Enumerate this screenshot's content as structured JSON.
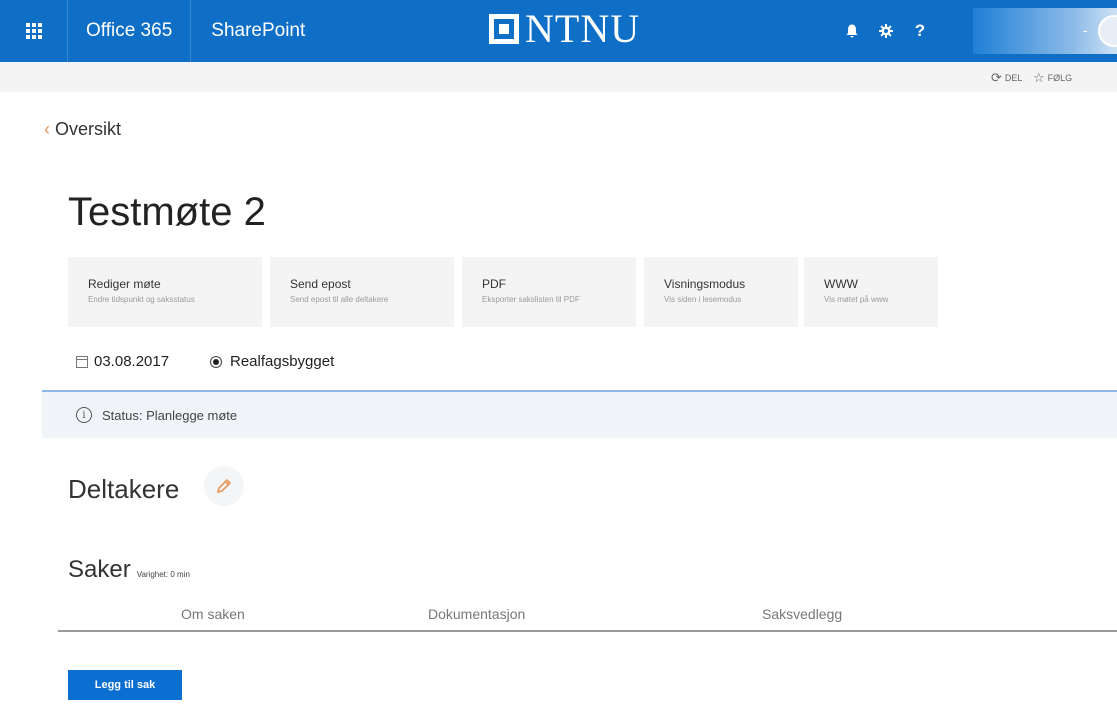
{
  "suitebar": {
    "app_name": "Office 365",
    "site_name": "SharePoint",
    "logo_text": "NTNU",
    "icons": [
      "bell-icon",
      "gear-icon",
      "help-icon"
    ],
    "help_label": "?",
    "user_separator": "-",
    "colors": {
      "bar": "#0f6fc6"
    }
  },
  "ribbon": {
    "share_label": "DEL",
    "follow_label": "FØLG"
  },
  "back_label": "Oversikt",
  "page_title": "Testmøte 2",
  "actions": [
    {
      "title": "Rediger møte",
      "subtitle": "Endre tidspunkt og saksstatus"
    },
    {
      "title": "Send epost",
      "subtitle": "Send epost til alle deltakere"
    },
    {
      "title": "PDF",
      "subtitle": "Eksporter sakslisten til PDF"
    },
    {
      "title": "Visningsmodus",
      "subtitle": "Vis siden i lesemodus"
    },
    {
      "title": "WWW",
      "subtitle": "Vis møtet på www"
    }
  ],
  "meeting": {
    "date": "03.08.2017",
    "location": "Realfagsbygget"
  },
  "status": {
    "text": "Status: Planlegge møte"
  },
  "participants": {
    "heading": "Deltakere"
  },
  "cases": {
    "heading": "Saker",
    "duration": "Varighet: 0 min",
    "columns": [
      "Om saken",
      "Dokumentasjon",
      "Saksvedlegg"
    ],
    "add_button": "Legg til sak"
  },
  "colors": {
    "accent": "#0a6fd1",
    "back_chevron": "#e8955a",
    "edit_pencil": "#e8955a"
  }
}
